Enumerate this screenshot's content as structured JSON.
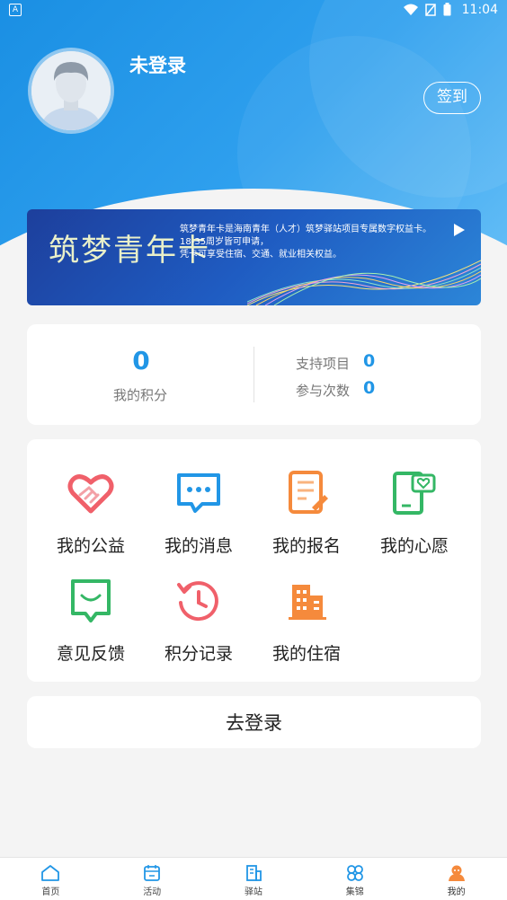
{
  "status_bar": {
    "time": "11:04",
    "app_indicator": "A"
  },
  "profile": {
    "username": "未登录",
    "checkin_label": "签到"
  },
  "banner": {
    "logo_text": "筑梦青年卡",
    "description_lines": [
      "筑梦青年卡是海南青年（人才）筑梦驿站项目专属数字权益卡。",
      "18-35周岁皆可申请，",
      "凭卡可享受住宿、交通、就业相关权益。"
    ]
  },
  "stats": {
    "points_value": "0",
    "points_label": "我的积分",
    "supported_label": "支持项目",
    "supported_value": "0",
    "participation_label": "参与次数",
    "participation_value": "0"
  },
  "menu": {
    "items": [
      {
        "label": "我的公益",
        "icon": "heart-handshake-icon",
        "color": "#f0606a"
      },
      {
        "label": "我的消息",
        "icon": "message-icon",
        "color": "#2196e6"
      },
      {
        "label": "我的报名",
        "icon": "form-edit-icon",
        "color": "#f58a3c"
      },
      {
        "label": "我的心愿",
        "icon": "wish-icon",
        "color": "#34b765"
      },
      {
        "label": "意见反馈",
        "icon": "feedback-icon",
        "color": "#34b765"
      },
      {
        "label": "积分记录",
        "icon": "history-icon",
        "color": "#f0606a"
      },
      {
        "label": "我的住宿",
        "icon": "building-icon",
        "color": "#f58a3c"
      }
    ]
  },
  "login_button": "去登录",
  "tabbar": {
    "tabs": [
      {
        "label": "首页",
        "icon": "home-icon"
      },
      {
        "label": "活动",
        "icon": "calendar-icon"
      },
      {
        "label": "驿站",
        "icon": "station-icon"
      },
      {
        "label": "集锦",
        "icon": "collection-icon"
      },
      {
        "label": "我的",
        "icon": "profile-icon",
        "active": true
      }
    ]
  },
  "colors": {
    "primary": "#2196e6",
    "header_start": "#1a8fe3",
    "header_end": "#63bdf6",
    "active_tab": "#f58a3c"
  }
}
